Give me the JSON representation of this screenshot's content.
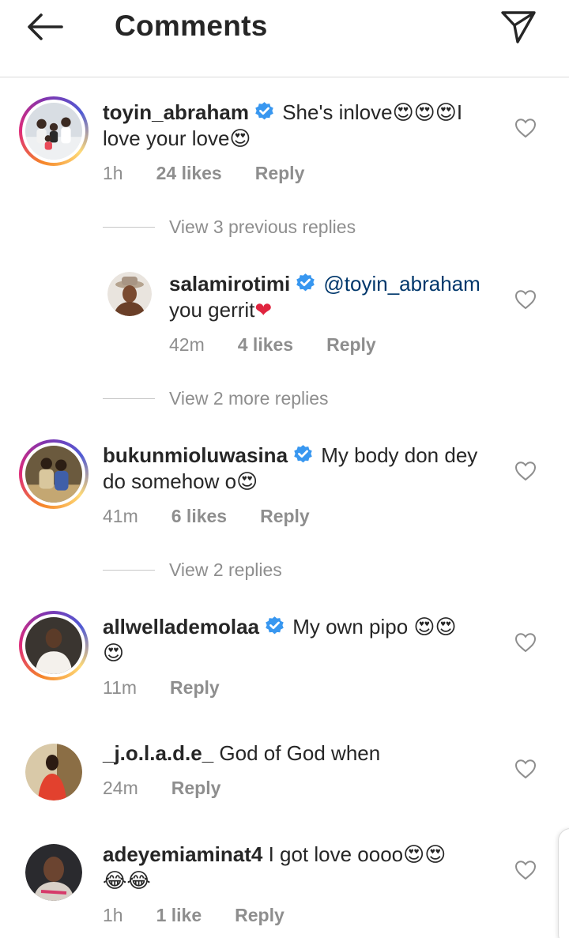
{
  "header": {
    "title": "Comments"
  },
  "comments": [
    {
      "username": "toyin_abraham",
      "verified": true,
      "text_line1": "She's inlove",
      "emojis_line1": "😍😍😍",
      "text_line1_tail": "I",
      "text_line2": "love your love",
      "emojis_line2": "😍",
      "time": "1h",
      "likes": "24 likes",
      "reply": "Reply",
      "avatar_icon": "family-photo-avatar"
    },
    {
      "username": "salamirotimi",
      "verified": true,
      "mention": "@toyin_abraham",
      "text_line2": "you gerrit",
      "emojis_line2": "❤",
      "time": "42m",
      "likes": "4 likes",
      "reply": "Reply",
      "avatar_icon": "man-with-hat-avatar"
    },
    {
      "username": "bukunmioluwasina",
      "verified": true,
      "text_line1": "My body don dey",
      "text_line2": "do somehow o",
      "emojis_line2": "😍",
      "time": "41m",
      "likes": "6 likes",
      "reply": "Reply",
      "avatar_icon": "couple-photo-avatar"
    },
    {
      "username": "allwellademolaa",
      "verified": true,
      "text_line1": "My own pipo ",
      "emojis_line1": "😍😍",
      "emojis_line2": "😍",
      "time": "11m",
      "reply": "Reply",
      "avatar_icon": "woman-white-dress-avatar"
    },
    {
      "username": "_j.o.l.a.d.e_",
      "verified": false,
      "text_line1": "God of God when",
      "time": "24m",
      "reply": "Reply",
      "avatar_icon": "woman-red-outfit-avatar"
    },
    {
      "username": "adeyemiaminat4",
      "verified": false,
      "text_line1": "I got love oooo",
      "emojis_line1": "😍😍",
      "emojis_line2": "😂😂",
      "time": "1h",
      "likes": "1 like",
      "reply": "Reply",
      "avatar_icon": "woman-selfie-avatar"
    }
  ],
  "view_replies": [
    "View 3 previous replies",
    "View 2 more replies",
    "View 2 replies"
  ],
  "colors": {
    "text": "#262626",
    "meta": "#8e8e8e",
    "verified_blue": "#3897f0",
    "mention": "#00376b",
    "divider": "#dbdbdb"
  }
}
